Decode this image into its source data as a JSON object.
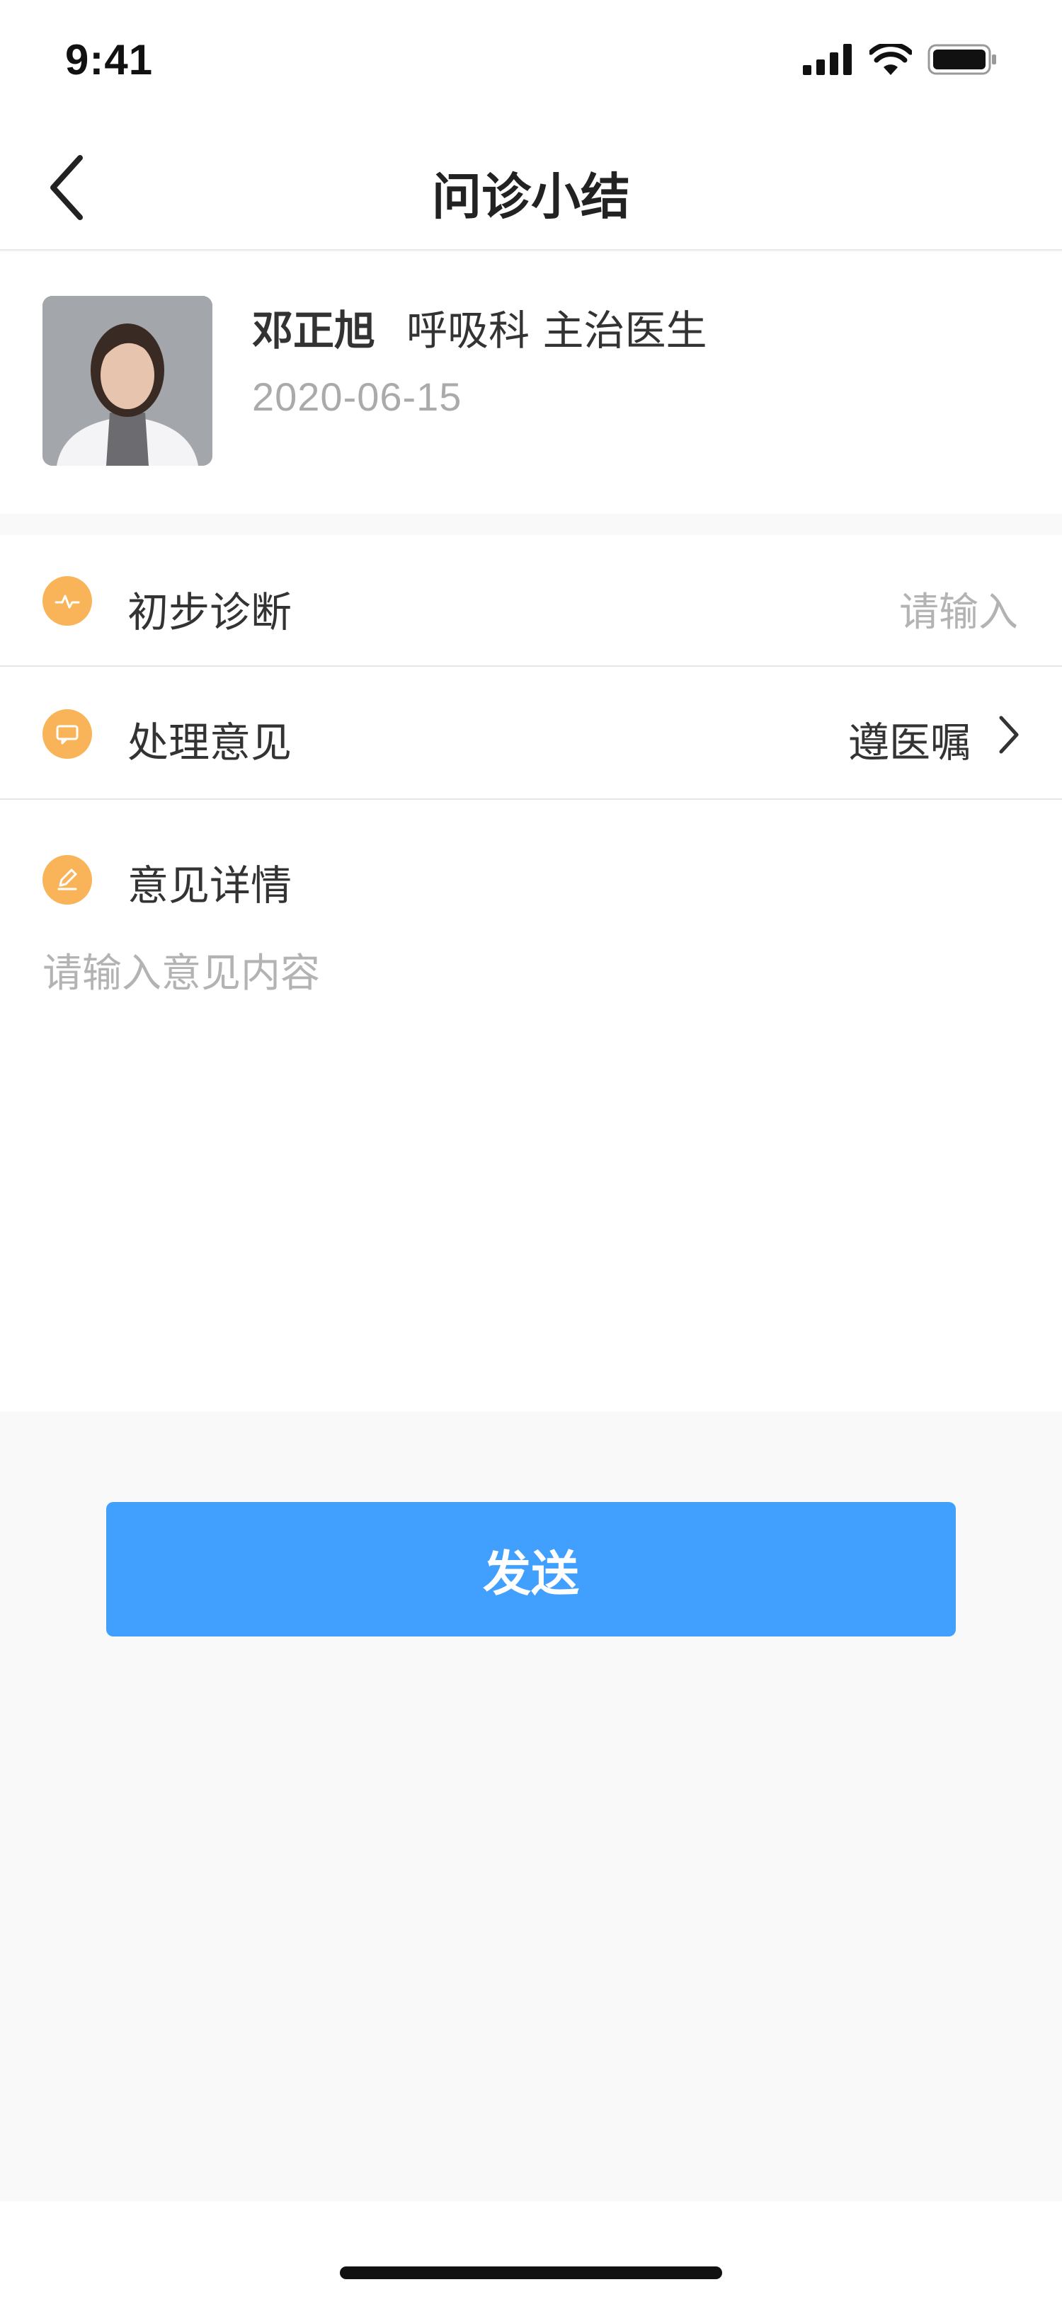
{
  "status_bar": {
    "time": "9:41",
    "icons": [
      "signal-icon",
      "wifi-icon",
      "battery-icon"
    ]
  },
  "nav": {
    "back_icon": "chevron-left-icon",
    "title": "问诊小结"
  },
  "doctor": {
    "name": "邓正旭",
    "department_title": "呼吸科 主治医生",
    "date": "2020-06-15"
  },
  "form": {
    "diagnosis": {
      "label": "初步诊断",
      "placeholder": "请输入",
      "icon": "heartbeat-icon"
    },
    "treatment": {
      "label": "处理意见",
      "value": "遵医嘱",
      "icon": "chat-bubble-icon"
    },
    "detail": {
      "label": "意见详情",
      "placeholder": "请输入意见内容",
      "icon": "pencil-icon"
    }
  },
  "actions": {
    "send_label": "发送"
  },
  "colors": {
    "accent": "#41a0fe",
    "icon_bg": "#f9b45a",
    "page_bg": "#f9f9f9",
    "placeholder": "#b3b3b3"
  }
}
